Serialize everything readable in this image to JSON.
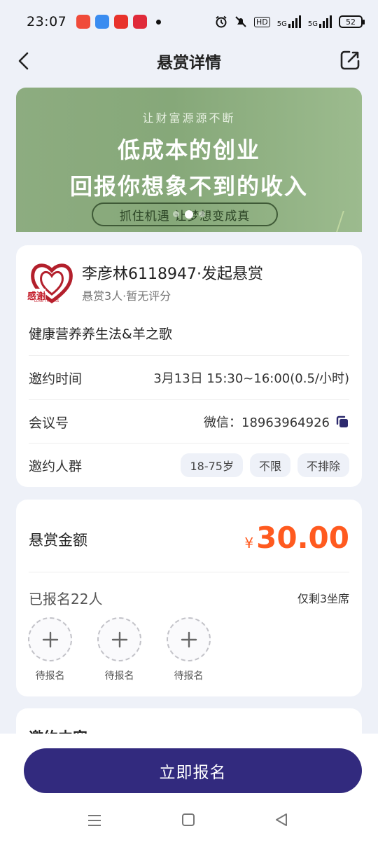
{
  "status_bar": {
    "time": "23:07",
    "network_label": "5G",
    "hd_label": "HD",
    "battery": "52",
    "app_icon_colors": [
      "#f04b3a",
      "#3a8cf0",
      "#e8322b",
      "#e02a3a"
    ]
  },
  "nav": {
    "title": "悬赏详情",
    "back_icon": "chevron-left-icon",
    "edit_icon": "edit-icon"
  },
  "banner": {
    "subtitle": "让财富源源不断",
    "line1": "低成本的创业",
    "line2": "回报你想象不到的收入",
    "pill": "抓住机遇 让梦想变成真",
    "slide_count": 3,
    "active_slide": 2
  },
  "host": {
    "logo_text": "感谢",
    "logo_subtext": "LOVE THANKS",
    "name": "李彦林6118947·发起悬赏",
    "meta": "悬赏3人·暂无评分"
  },
  "topic": "健康营养养生法&羊之歌",
  "details": {
    "time_label": "邀约时间",
    "time_value": "3月13日 15:30~16:00(0.5/小时)",
    "meeting_label": "会议号",
    "meeting_value": "微信：18963964926",
    "audience_label": "邀约人群",
    "audience_tags": [
      "18-75岁",
      "不限",
      "不排除"
    ]
  },
  "reward": {
    "label": "悬赏金额",
    "currency": "¥",
    "amount": "30.00",
    "color": "#ff5a1f"
  },
  "signup": {
    "signed_text": "已报名22人",
    "remaining_text": "仅剩3坐席",
    "slot_label": "待报名",
    "slots": [
      "待报名",
      "待报名",
      "待报名"
    ]
  },
  "content_section": {
    "title": "邀约内容"
  },
  "cta": {
    "label": "立即报名",
    "color": "#322a7e"
  }
}
